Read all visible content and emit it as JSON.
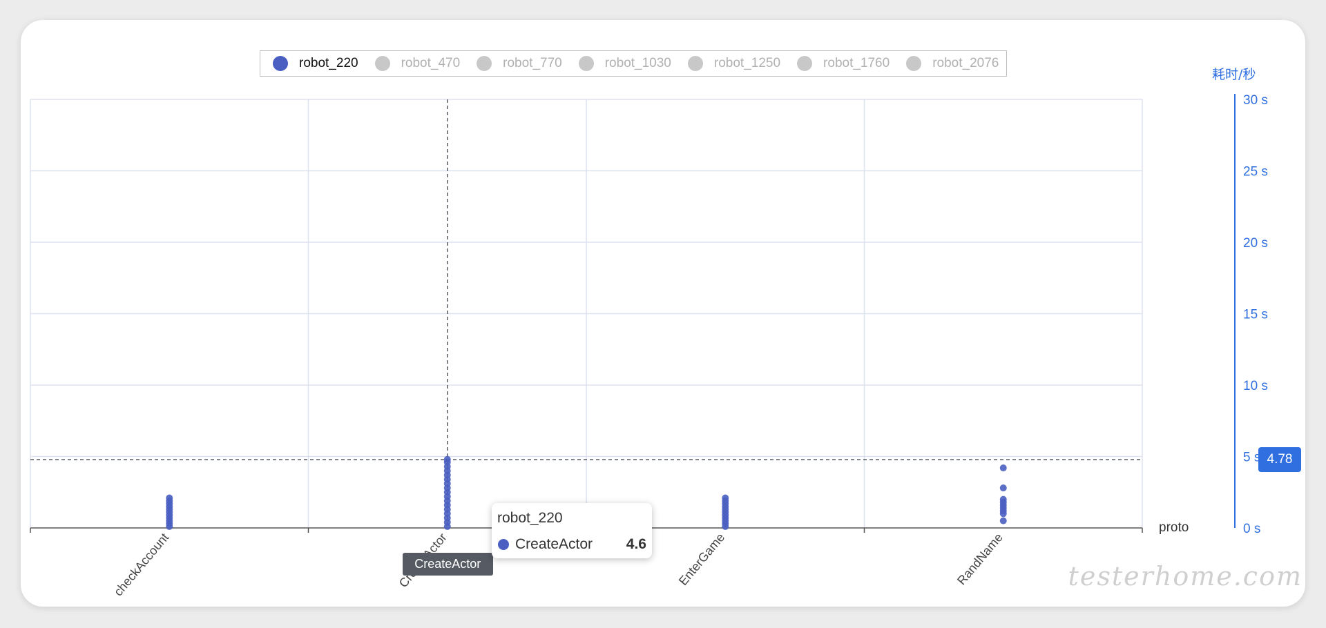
{
  "legend": [
    {
      "name": "robot_220",
      "active": true
    },
    {
      "name": "robot_470",
      "active": false
    },
    {
      "name": "robot_770",
      "active": false
    },
    {
      "name": "robot_1030",
      "active": false
    },
    {
      "name": "robot_1250",
      "active": false
    },
    {
      "name": "robot_1760",
      "active": false
    },
    {
      "name": "robot_2076",
      "active": false
    }
  ],
  "colors": {
    "series": "#4a5fc1",
    "inactive": "#c8c8c8",
    "yaxis": "#2f6fe0",
    "grid": "#dde2f0",
    "pointer": "#555a63"
  },
  "tooltip": {
    "title": "robot_220",
    "item_name": "CreateActor",
    "item_value": "4.6"
  },
  "axis_pointer": {
    "x_label": "CreateActor",
    "y_label": "4.78"
  },
  "watermark": "testerhome.com",
  "chart_data": {
    "type": "scatter",
    "categories": [
      "checkAccount",
      "CreateActor",
      "EnterGame",
      "RandName"
    ],
    "xlabel": "proto",
    "ylabel": "耗时/秒",
    "ylim": [
      0,
      30
    ],
    "yticks": [
      0,
      5,
      10,
      15,
      20,
      25,
      30
    ],
    "ytick_suffix": " s",
    "grid": true,
    "legend_position": "top",
    "series": [
      {
        "name": "robot_220",
        "points": [
          {
            "x": "checkAccount",
            "y": [
              0.1,
              0.3,
              0.5,
              0.7,
              0.9,
              1.1,
              1.3,
              1.5,
              1.7,
              1.9,
              2.1
            ]
          },
          {
            "x": "CreateActor",
            "y": [
              0.1,
              0.4,
              0.7,
              1.0,
              1.3,
              1.6,
              1.9,
              2.2,
              2.5,
              2.8,
              3.1,
              3.4,
              3.7,
              4.0,
              4.3,
              4.6,
              4.8
            ]
          },
          {
            "x": "EnterGame",
            "y": [
              0.1,
              0.3,
              0.5,
              0.7,
              0.9,
              1.1,
              1.3,
              1.5,
              1.7,
              1.9,
              2.1
            ]
          },
          {
            "x": "RandName",
            "y": [
              0.5,
              1.0,
              1.2,
              1.4,
              1.6,
              1.8,
              2.0,
              2.8,
              4.2
            ]
          }
        ]
      }
    ]
  }
}
